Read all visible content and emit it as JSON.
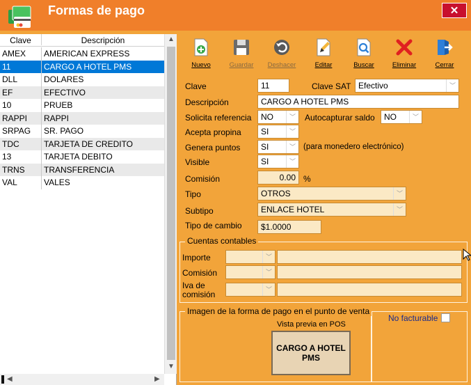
{
  "window": {
    "title": "Formas de pago",
    "close_label": "✕"
  },
  "list": {
    "columns": [
      "Clave",
      "Descripción"
    ],
    "rows": [
      {
        "clave": "AMEX",
        "desc": "AMERICAN EXPRESS"
      },
      {
        "clave": "11",
        "desc": "CARGO A HOTEL PMS",
        "selected": true
      },
      {
        "clave": "DLL",
        "desc": "DOLARES"
      },
      {
        "clave": "EF",
        "desc": "EFECTIVO"
      },
      {
        "clave": "10",
        "desc": "PRUEB"
      },
      {
        "clave": "RAPPI",
        "desc": "RAPPI"
      },
      {
        "clave": "SRPAG",
        "desc": "SR. PAGO"
      },
      {
        "clave": "TDC",
        "desc": "TARJETA DE CREDITO"
      },
      {
        "clave": "13",
        "desc": "TARJETA DEBITO"
      },
      {
        "clave": "TRNS",
        "desc": "TRANSFERENCIA"
      },
      {
        "clave": "VAL",
        "desc": "VALES"
      }
    ]
  },
  "toolbar": {
    "nuevo": "Nuevo",
    "guardar": "Guardar",
    "deshacer": "Deshacer",
    "editar": "Editar",
    "buscar": "Buscar",
    "eliminar": "Eliminar",
    "cerrar": "Cerrar"
  },
  "form": {
    "clave_label": "Clave",
    "clave_value": "11",
    "clave_sat_label": "Clave SAT",
    "clave_sat_value": "Efectivo",
    "descripcion_label": "Descripción",
    "descripcion_value": "CARGO A HOTEL PMS",
    "solicita_label": "Solicita referencia",
    "solicita_value": "NO",
    "autocapturar_label": "Autocapturar saldo",
    "autocapturar_value": "NO",
    "propina_label": "Acepta propina",
    "propina_value": "SI",
    "puntos_label": "Genera puntos",
    "puntos_value": "SI",
    "puntos_note": "(para monedero electrónico)",
    "visible_label": "Visible",
    "visible_value": "SI",
    "comision_label": "Comisión",
    "comision_value": "0.00",
    "comision_unit": "%",
    "tipo_label": "Tipo",
    "tipo_value": "OTROS",
    "subtipo_label": "Subtipo",
    "subtipo_value": "ENLACE HOTEL",
    "cambio_label": "Tipo de cambio",
    "cambio_value": "$1.0000"
  },
  "cuentas": {
    "title": "Cuentas contables",
    "importe_label": "Importe",
    "comision_label": "Comisión",
    "iva_label_1": "Iva de",
    "iva_label_2": "comisión"
  },
  "imagen": {
    "title": "Imagen de la forma de pago en el punto de venta",
    "preview_label": "Vista previa en POS",
    "preview_button": "CARGO A HOTEL PMS",
    "no_facturable_label": "No facturable"
  },
  "colors": {
    "titlebar": "#f07f2a",
    "panel": "#f2a43a",
    "selection": "#0078d7",
    "close": "#c8102e"
  }
}
